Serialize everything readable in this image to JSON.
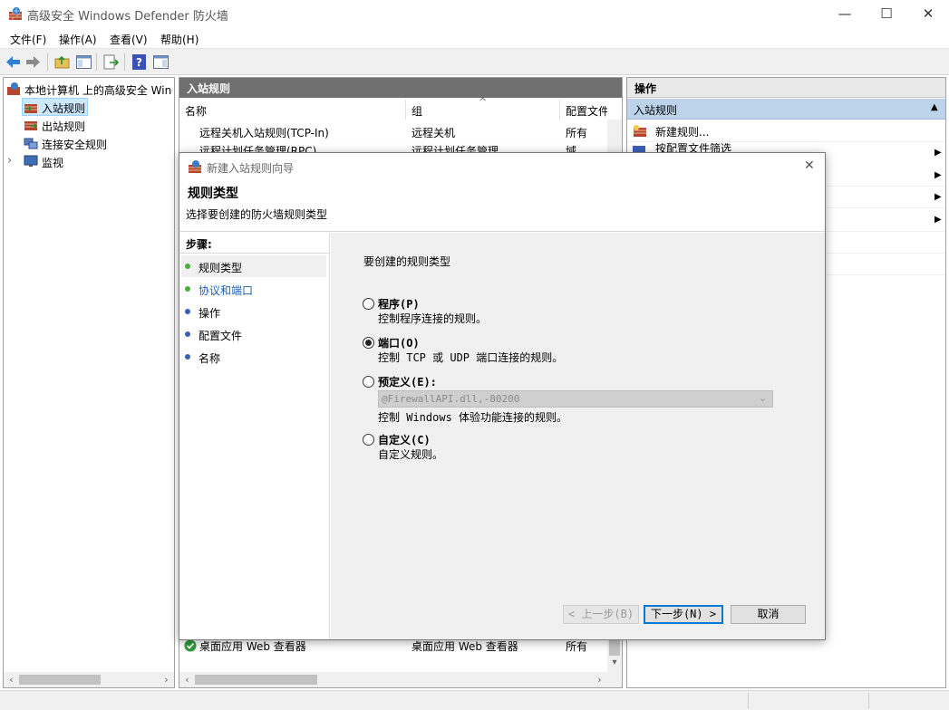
{
  "window": {
    "title": "高级安全 Windows Defender 防火墙",
    "minimize": "—",
    "maximize": "☐",
    "close": "✕"
  },
  "menu": [
    "文件(F)",
    "操作(A)",
    "查看(V)",
    "帮助(H)"
  ],
  "tree": {
    "root": "本地计算机 上的高级安全 Windows Defender 防火墙",
    "items": [
      "入站规则",
      "出站规则",
      "连接安全规则",
      "监视"
    ],
    "expand_glyph": "›"
  },
  "middle": {
    "header": "入站规则",
    "columns": [
      "名称",
      "组",
      "配置文件"
    ],
    "sort_glyph": "^",
    "rows": [
      {
        "name": "远程关机入站规则(TCP-In)",
        "group": "远程关机",
        "profile": "所有"
      },
      {
        "name": "远程计划任务管理(RPC)",
        "group": "远程计划任务管理",
        "profile": "域"
      },
      {
        "name": "桌面应用 Web 查看器",
        "group": "桌面应用 Web 查看器",
        "profile": "所有"
      }
    ]
  },
  "actions": {
    "header": "操作",
    "section": "入站规则",
    "items": [
      "新建规则...",
      "按配置文件筛选"
    ]
  },
  "dialog": {
    "title": "新建入站规则向导",
    "close": "✕",
    "heading": "规则类型",
    "subheading": "选择要创建的防火墙规则类型",
    "steps_title": "步骤:",
    "steps": [
      "规则类型",
      "协议和端口",
      "操作",
      "配置文件",
      "名称"
    ],
    "question": "要创建的规则类型",
    "options": [
      {
        "label": "程序(P)",
        "desc": "控制程序连接的规则。",
        "selected": false
      },
      {
        "label": "端口(O)",
        "desc": "控制 TCP 或 UDP 端口连接的规则。",
        "selected": true
      },
      {
        "label": "预定义(E):",
        "desc": "控制 Windows 体验功能连接的规则。",
        "selected": false
      },
      {
        "label": "自定义(C)",
        "desc": "自定义规则。",
        "selected": false
      }
    ],
    "predefined_value": "@FirewallAPI.dll,-80200",
    "buttons": {
      "back": "< 上一步(B)",
      "next": "下一步(N) >",
      "cancel": "取消"
    }
  },
  "colors": {
    "accent": "#0078d7",
    "step_green": "#4cae3a",
    "step_blue": "#3b5fb5",
    "link": "#1a5fb4"
  }
}
